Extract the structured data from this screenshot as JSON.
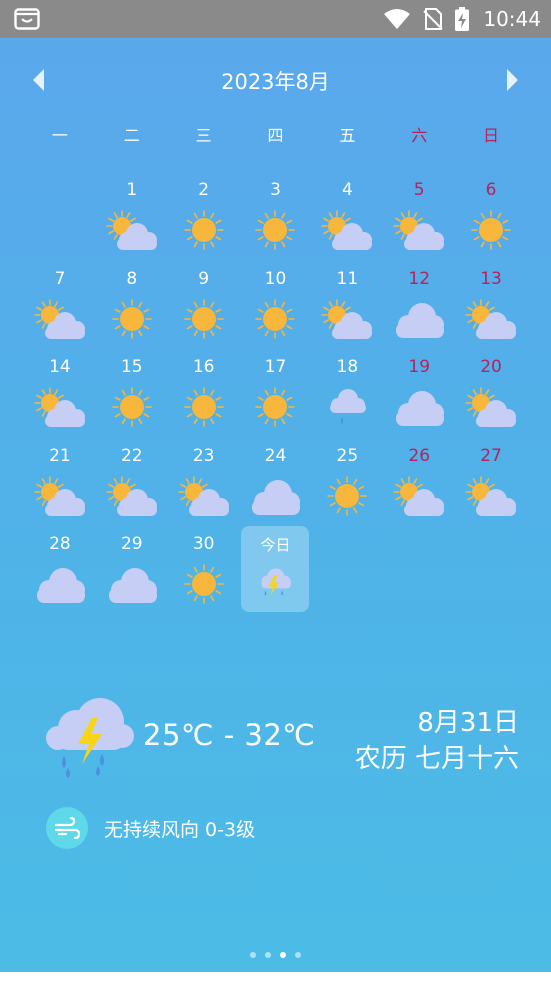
{
  "status_bar": {
    "time": "10:44"
  },
  "calendar": {
    "title": "2023年8月",
    "weekdays": [
      "一",
      "二",
      "三",
      "四",
      "五",
      "六",
      "日"
    ],
    "days": [
      {
        "day": "",
        "weather": "none"
      },
      {
        "day": "1",
        "weather": "partly-cloudy"
      },
      {
        "day": "2",
        "weather": "sunny"
      },
      {
        "day": "3",
        "weather": "sunny"
      },
      {
        "day": "4",
        "weather": "partly-cloudy"
      },
      {
        "day": "5",
        "weather": "partly-cloudy"
      },
      {
        "day": "6",
        "weather": "sunny"
      },
      {
        "day": "7",
        "weather": "partly-cloudy"
      },
      {
        "day": "8",
        "weather": "sunny"
      },
      {
        "day": "9",
        "weather": "sunny"
      },
      {
        "day": "10",
        "weather": "sunny"
      },
      {
        "day": "11",
        "weather": "partly-cloudy"
      },
      {
        "day": "12",
        "weather": "cloudy"
      },
      {
        "day": "13",
        "weather": "partly-cloudy"
      },
      {
        "day": "14",
        "weather": "partly-cloudy"
      },
      {
        "day": "15",
        "weather": "sunny"
      },
      {
        "day": "16",
        "weather": "sunny"
      },
      {
        "day": "17",
        "weather": "sunny"
      },
      {
        "day": "18",
        "weather": "light-rain"
      },
      {
        "day": "19",
        "weather": "cloudy"
      },
      {
        "day": "20",
        "weather": "partly-cloudy"
      },
      {
        "day": "21",
        "weather": "partly-cloudy"
      },
      {
        "day": "22",
        "weather": "partly-cloudy"
      },
      {
        "day": "23",
        "weather": "partly-cloudy"
      },
      {
        "day": "24",
        "weather": "cloudy"
      },
      {
        "day": "25",
        "weather": "sunny"
      },
      {
        "day": "26",
        "weather": "partly-cloudy"
      },
      {
        "day": "27",
        "weather": "partly-cloudy"
      },
      {
        "day": "28",
        "weather": "cloudy"
      },
      {
        "day": "29",
        "weather": "cloudy"
      },
      {
        "day": "30",
        "weather": "sunny"
      },
      {
        "day": "今日",
        "weather": "thunderstorm",
        "today": true
      }
    ]
  },
  "current": {
    "temp_range": "25℃ - 32℃",
    "date": "8月31日",
    "lunar": "农历 七月十六",
    "weather": "thunderstorm"
  },
  "wind": {
    "text": "无持续风向 0-3级",
    "icon": "wind-icon"
  },
  "pager": {
    "count": 4,
    "active": 2
  },
  "colors": {
    "weekend_red": "#b4235d",
    "sun": "#f6b73c",
    "cloud": "#c6cef5",
    "wind_badge": "#5fd8ea"
  }
}
